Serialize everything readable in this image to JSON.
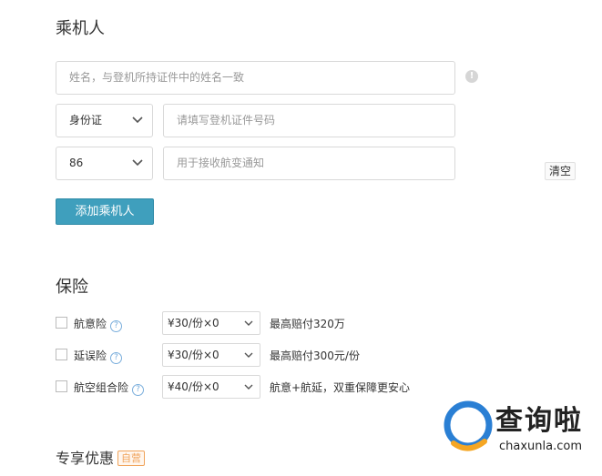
{
  "passenger": {
    "title": "乘机人",
    "name_placeholder": "姓名，与登机所持证件中的姓名一致",
    "info_icon_glyph": "!",
    "id_type_selected": "身份证",
    "id_placeholder": "请填写登机证件号码",
    "country_code_selected": "86",
    "phone_placeholder": "用于接收航变通知",
    "clear_label": "清空",
    "add_label": "添加乘机人"
  },
  "insurance": {
    "title": "保险",
    "items": [
      {
        "name": "航意险",
        "option": "¥30/份×0",
        "desc": "最高赔付320万"
      },
      {
        "name": "延误险",
        "option": "¥30/份×0",
        "desc": "最高赔付300元/份"
      },
      {
        "name": "航空组合险",
        "option": "¥40/份×0",
        "desc": "航意+航延，双重保障更安心"
      }
    ]
  },
  "promo": {
    "title": "专享优惠",
    "badge": "自营"
  },
  "watermark": {
    "text": "查询啦",
    "url": "chaxunla.com",
    "accent_color": "#2a7fd4",
    "accent_color_2": "#f5a623"
  },
  "icons": {
    "dropdown": "chevron-down-icon",
    "help": "question-circle-icon",
    "info": "exclamation-circle-icon"
  }
}
